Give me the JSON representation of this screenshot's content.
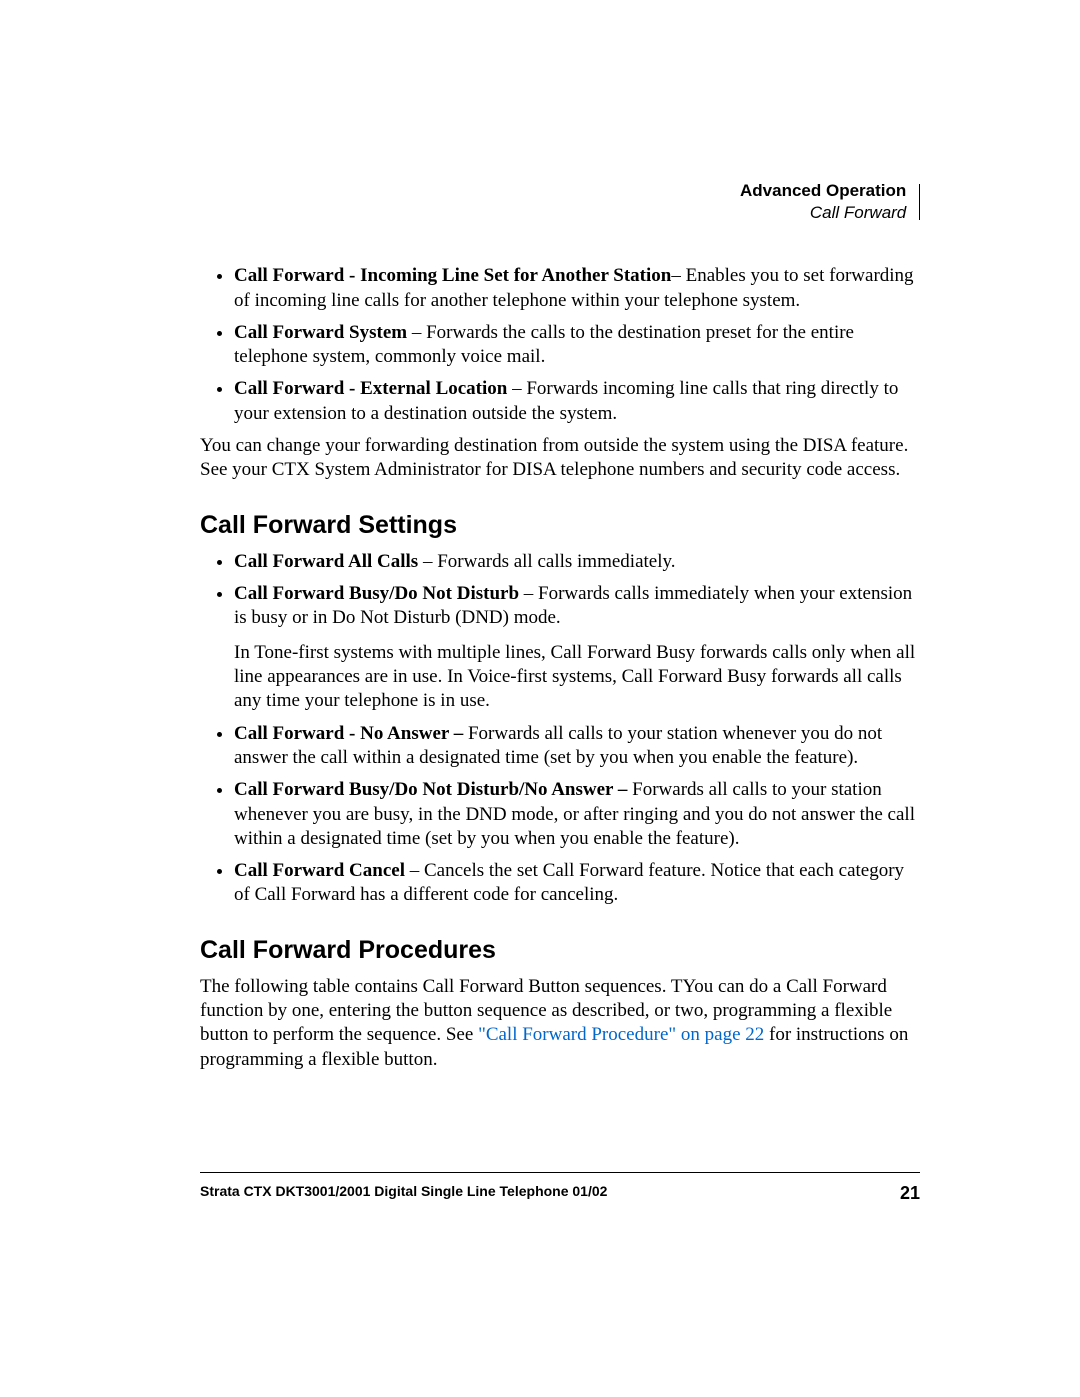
{
  "header": {
    "chapter": "Advanced Operation",
    "section": "Call Forward"
  },
  "top_bullets": [
    {
      "bold": "Call Forward - Incoming Line Set for Another Station",
      "sep": "– ",
      "text": "Enables you to set forwarding of incoming line calls for another telephone within your telephone system."
    },
    {
      "bold": "Call Forward System",
      "sep": " – ",
      "text": "Forwards the calls to the destination preset for the entire telephone system, commonly voice mail."
    },
    {
      "bold": "Call Forward - External Location",
      "sep": " – ",
      "text": "Forwards incoming line calls that ring directly to your extension to a destination outside the system."
    }
  ],
  "top_para": "You can change your forwarding destination from outside the system using the DISA feature. See your CTX System Administrator for DISA telephone numbers and security code access.",
  "h_settings": "Call Forward Settings",
  "settings_bullets": [
    {
      "bold": "Call Forward All Calls",
      "sep": " – ",
      "text": "Forwards all calls immediately."
    },
    {
      "bold": "Call Forward Busy/Do Not Disturb",
      "sep": " – ",
      "text": "Forwards calls immediately when your extension is busy or in Do Not Disturb (DND) mode.",
      "extra": "In Tone-first systems with multiple lines, Call Forward Busy forwards calls only when all line appearances are in use. In Voice-first systems, Call Forward Busy forwards all calls any time your telephone is in use."
    },
    {
      "bold": "Call Forward - No Answer –",
      "sep": " ",
      "text": "Forwards all calls to your station whenever you do not answer the call within a designated time (set by you when you enable the feature)."
    },
    {
      "bold": "Call Forward Busy/Do Not Disturb/No Answer –",
      "sep": " ",
      "text": "Forwards all calls to your station whenever you are busy, in the DND mode, or after ringing and you do not answer the call within a designated time (set by you when you enable the feature)."
    },
    {
      "bold": "Call Forward Cancel",
      "sep": " – ",
      "text": "Cancels the set Call Forward feature. Notice that each category of Call Forward has a different code for canceling."
    }
  ],
  "h_procedures": "Call Forward Procedures",
  "proc_para_pre": "The following table contains Call Forward Button sequences. TYou can do a Call Forward function by one, entering the button sequence as described, or two, programming a flexible button to perform the sequence. See ",
  "proc_link": "\"Call Forward Procedure\" on page 22",
  "proc_para_post": " for instructions on programming a flexible button.",
  "footer": {
    "doc": "Strata CTX DKT3001/2001 Digital Single Line Telephone    01/02",
    "page": "21"
  }
}
